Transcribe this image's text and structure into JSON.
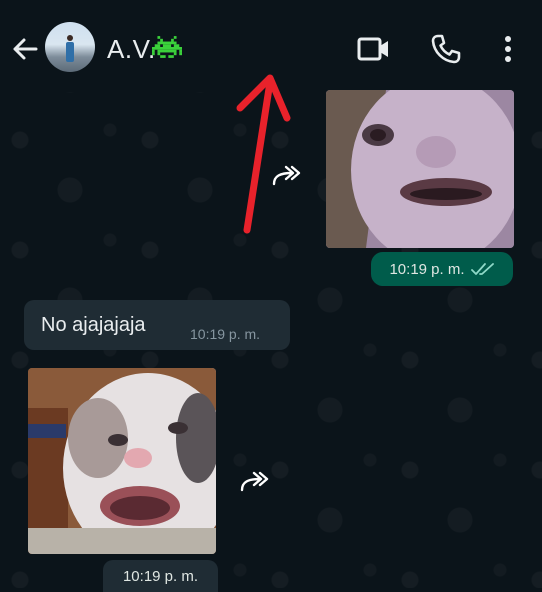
{
  "header": {
    "contact_name": "A.V.",
    "icons": {
      "back": "arrow-left-icon",
      "alien": "space-invader-emoji",
      "video": "video-camera-icon",
      "call": "phone-icon",
      "menu": "more-vertical-icon"
    }
  },
  "messages": {
    "outgoing_photo": {
      "time": "10:19 p. m.",
      "status": "read"
    },
    "incoming_text": {
      "text": "No ajajajaja",
      "time": "10:19 p. m."
    },
    "incoming_photo": {
      "time": "10:19 p. m."
    }
  },
  "colors": {
    "background": "#0b141a",
    "outgoing_bubble": "#005c4b",
    "incoming_bubble": "#1f2c34",
    "annotation_arrow": "#e8222b",
    "read_ticks": "#8fd9c8"
  }
}
